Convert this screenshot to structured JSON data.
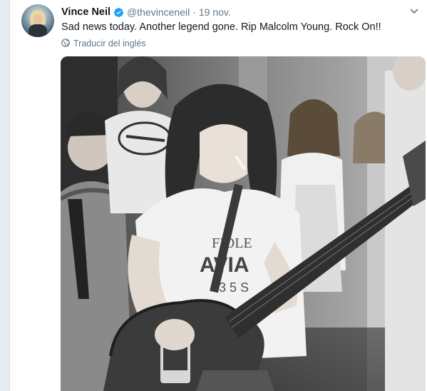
{
  "tweet": {
    "author_name": "Vince Neil",
    "handle": "@thevinceneil",
    "separator": "·",
    "timestamp": "19 nov.",
    "text": "Sad news today. Another legend gone. Rip Malcolm Young. Rock On!!",
    "translate_label": "Traducir del inglés",
    "image_shirt_text": [
      "FIDLE",
      "AVIA",
      "3 5 S"
    ]
  },
  "icons": {
    "verified": "verified-badge-icon",
    "menu": "chevron-down-icon",
    "translate": "globe-icon"
  },
  "colors": {
    "name_text": "#14171a",
    "secondary_text": "#657786",
    "verified_blue": "#1da1f2",
    "page_edge": "#e6ecf0"
  }
}
